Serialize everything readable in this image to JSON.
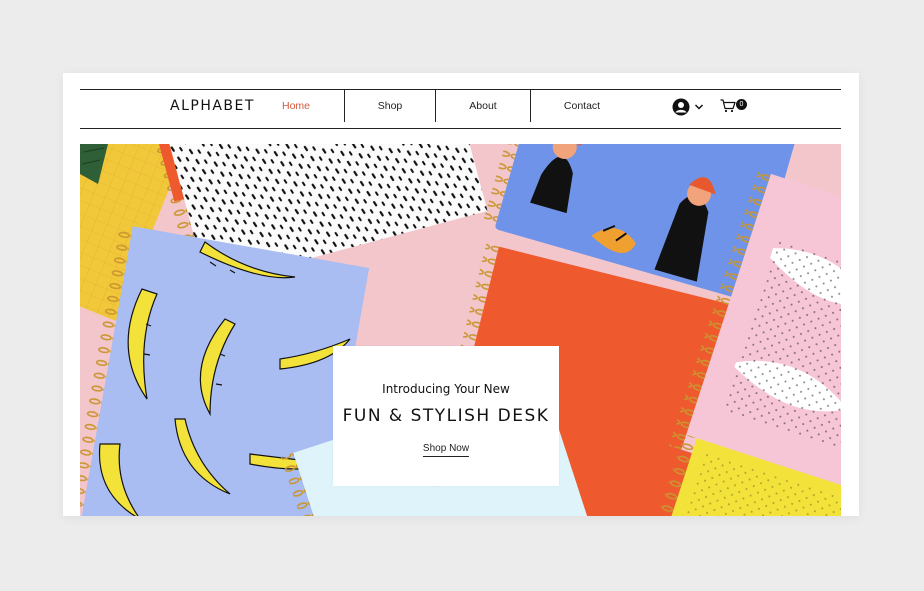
{
  "site": {
    "logo": "ALPHABET",
    "accent_color": "#d65a3c"
  },
  "nav": {
    "items": [
      {
        "label": "Home",
        "active": true
      },
      {
        "label": "Shop",
        "active": false
      },
      {
        "label": "About",
        "active": false
      },
      {
        "label": "Contact",
        "active": false
      }
    ]
  },
  "header_icons": {
    "user": "user-avatar-icon",
    "chevron": "chevron-down-icon",
    "cart": "cart-icon",
    "cart_count": "0"
  },
  "hero": {
    "intro": "Introducing Your New",
    "title": "FUN & STYLISH DESK",
    "cta": "Shop Now",
    "colors": {
      "background": "#f3c6cc",
      "blue_notebook": "#a9bdf2",
      "banana": "#f3e23a",
      "orange_notebook": "#ee5a2e",
      "sky_notebook": "#6f93e8",
      "yellow_notebook": "#f2c83b"
    }
  }
}
